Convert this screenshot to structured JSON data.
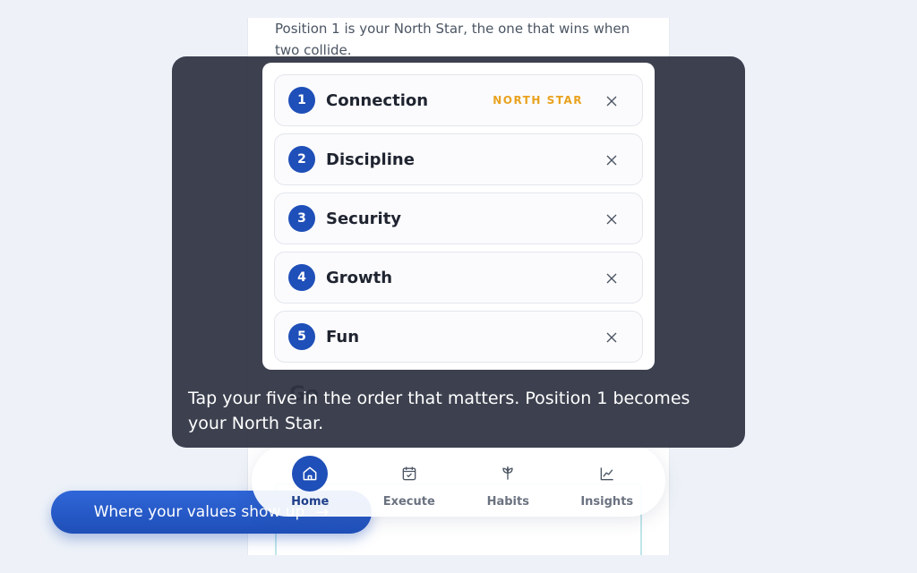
{
  "intro": {
    "text": "Position 1 is your North Star, the one that wins when two collide."
  },
  "peek_heading": "Go",
  "values": {
    "items": [
      {
        "rank": "1",
        "name": "Connection",
        "badge": "NORTH STAR"
      },
      {
        "rank": "2",
        "name": "Discipline",
        "badge": ""
      },
      {
        "rank": "3",
        "name": "Security",
        "badge": ""
      },
      {
        "rank": "4",
        "name": "Growth",
        "badge": ""
      },
      {
        "rank": "5",
        "name": "Fun",
        "badge": ""
      }
    ]
  },
  "coach": {
    "caption": "Tap your five in the order that matters. Position 1 becomes your North Star."
  },
  "cta": {
    "label": "Where your values show up",
    "icon": "arrow-right-icon"
  },
  "nav": {
    "items": [
      {
        "label": "Home",
        "icon": "home-icon",
        "active": true
      },
      {
        "label": "Execute",
        "icon": "calendar-check-icon",
        "active": false
      },
      {
        "label": "Habits",
        "icon": "sprout-icon",
        "active": false
      },
      {
        "label": "Insights",
        "icon": "trend-chart-icon",
        "active": false
      }
    ]
  },
  "colors": {
    "accent": "#1f4fb8",
    "north_star": "#e9a21f",
    "overlay": "#2e3342"
  }
}
